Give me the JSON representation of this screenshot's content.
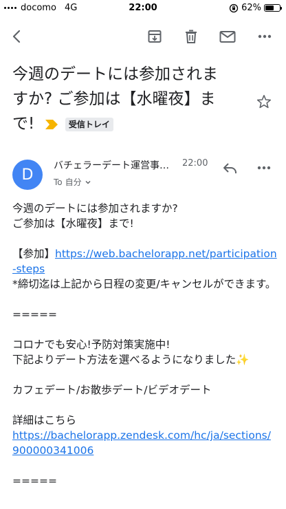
{
  "status_bar": {
    "carrier": "docomo",
    "network": "4G",
    "time": "22:00",
    "battery": "62%",
    "battery_level": 0.62
  },
  "toolbar": {
    "back": "arrow-back-icon",
    "archive": "archive-icon",
    "delete": "trash-icon",
    "mark_unread": "mail-icon",
    "more": "more-horizontal-icon"
  },
  "email": {
    "subject_line1": "今週のデートには参加されま",
    "subject_line2": "すか? ご参加は【水曜夜】ま",
    "subject_line3": "で!",
    "label": "受信トレイ",
    "sender": {
      "initial": "D",
      "name": "バチェラーデート運営事務局",
      "time": "22:00",
      "to_prefix": "To",
      "to": "自分"
    },
    "body": {
      "line1": "今週のデートには参加されますか?",
      "line2": "ご参加は【水曜夜】まで!",
      "join_prefix": "【参加】",
      "join_link": "https://web.bachelorapp.net/participation-steps",
      "deadline_note": "*締切迄は上記から日程の変更/キャンセルができます。",
      "divider1": "=====",
      "corona_line1": "コロナでも安心!予防対策実施中!",
      "corona_line2": "下記よりデート方法を選べるようになりました",
      "sparkle": "✨",
      "date_types": "カフェデート/お散歩デート/ビデオデート",
      "details_label": "詳細はこちら",
      "details_link": "https://bachelorapp.zendesk.com/hc/ja/sections/900000341006",
      "divider2": "====="
    }
  },
  "colors": {
    "accent": "#1a73e8",
    "avatar": "#4285f4",
    "label_arrow": "#f6b400",
    "icon": "#5f6368"
  }
}
